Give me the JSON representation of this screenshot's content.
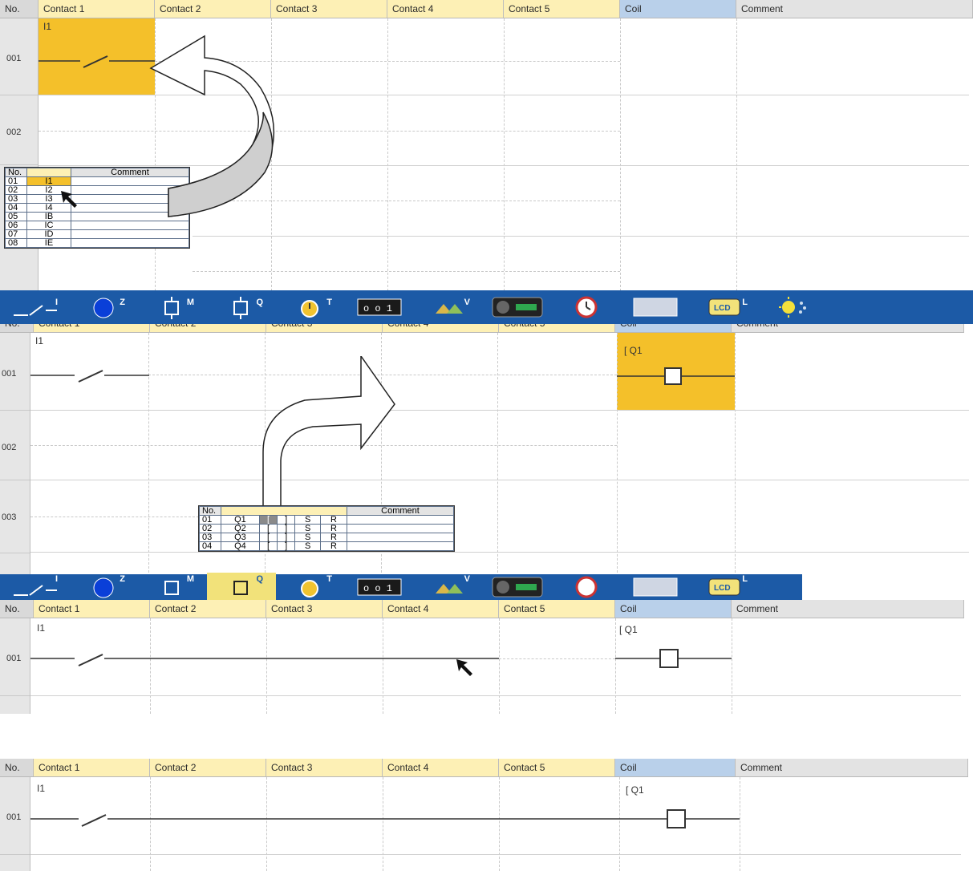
{
  "columns": {
    "no": "No.",
    "contact1": "Contact 1",
    "contact2": "Contact 2",
    "contact3": "Contact 3",
    "contact4": "Contact 4",
    "contact5": "Contact 5",
    "coil": "Coil",
    "comment": "Comment"
  },
  "rows": [
    "001",
    "002",
    "003"
  ],
  "contact_label": "I1",
  "coil_label": "Q1",
  "input_popup": {
    "headers": [
      "No.",
      "",
      "Comment"
    ],
    "items": [
      {
        "no": "01",
        "name": "I1"
      },
      {
        "no": "02",
        "name": "I2"
      },
      {
        "no": "03",
        "name": "I3"
      },
      {
        "no": "04",
        "name": "I4"
      },
      {
        "no": "05",
        "name": "IB"
      },
      {
        "no": "06",
        "name": "IC"
      },
      {
        "no": "07",
        "name": "ID"
      },
      {
        "no": "08",
        "name": "IE"
      }
    ]
  },
  "output_popup": {
    "headers": [
      "No.",
      "",
      "Comment"
    ],
    "items": [
      {
        "no": "01",
        "name": "Q1",
        "a": "[",
        "b": "]",
        "s": "S",
        "r": "R"
      },
      {
        "no": "02",
        "name": "Q2",
        "a": "[",
        "b": "]",
        "s": "S",
        "r": "R"
      },
      {
        "no": "03",
        "name": "Q3",
        "a": "[",
        "b": "]",
        "s": "S",
        "r": "R"
      },
      {
        "no": "04",
        "name": "Q4",
        "a": "[",
        "b": "]",
        "s": "S",
        "r": "R"
      }
    ]
  },
  "toolbar": [
    {
      "icon": "input-contact-icon",
      "sup": "I"
    },
    {
      "icon": "blue-circle-icon",
      "sup": "Z"
    },
    {
      "icon": "aux-relay-icon",
      "sup": "M"
    },
    {
      "icon": "output-relay-icon",
      "sup": "Q"
    },
    {
      "icon": "timer-icon",
      "sup": "T"
    },
    {
      "icon": "counter-icon",
      "sup": ""
    },
    {
      "icon": "analog-compare-icon",
      "sup": "V"
    },
    {
      "icon": "hmi-icon",
      "sup": ""
    },
    {
      "icon": "clock-icon",
      "sup": ""
    },
    {
      "icon": "keypad-icon",
      "sup": ""
    },
    {
      "icon": "lcd-icon",
      "sup": "L"
    },
    {
      "icon": "light-icon",
      "sup": ""
    }
  ],
  "colors": {
    "selected": "#f4c02a",
    "toolbar": "#1c5aa6",
    "contact_header": "#fdf0b5",
    "coil_header": "#b9d0ea"
  }
}
